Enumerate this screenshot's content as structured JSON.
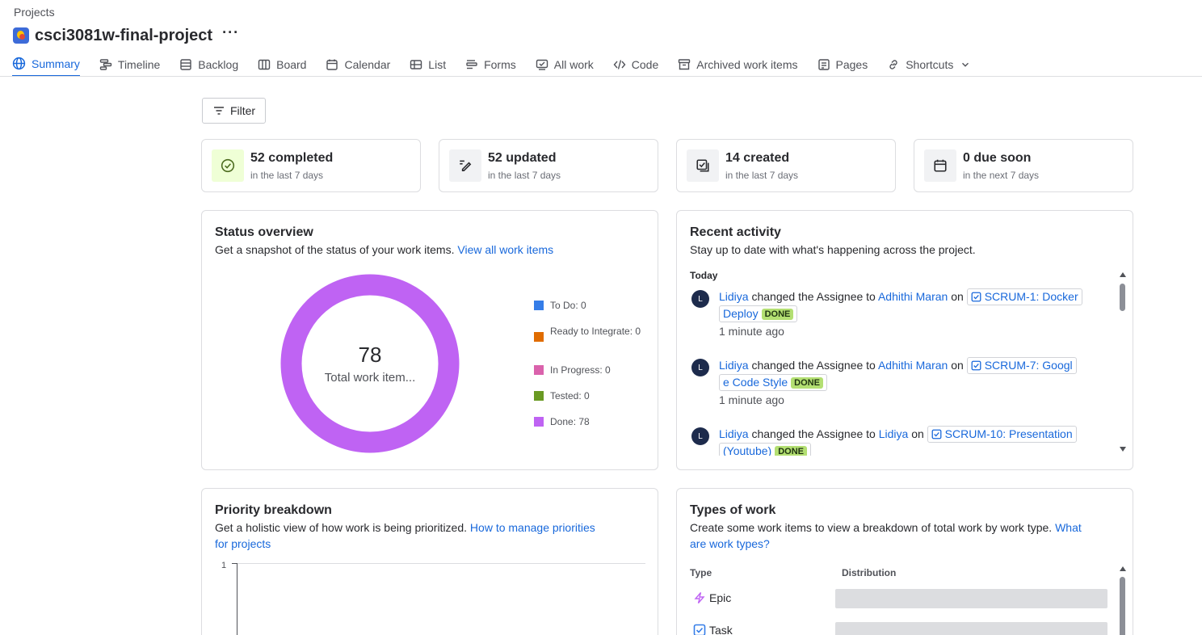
{
  "breadcrumb": "Projects",
  "project": {
    "name": "csci3081w-final-project",
    "more_label": "···"
  },
  "tabs": [
    {
      "label": "Summary",
      "icon": "globe-icon",
      "active": true
    },
    {
      "label": "Timeline",
      "icon": "timeline-icon"
    },
    {
      "label": "Backlog",
      "icon": "backlog-icon"
    },
    {
      "label": "Board",
      "icon": "board-icon"
    },
    {
      "label": "Calendar",
      "icon": "calendar-icon"
    },
    {
      "label": "List",
      "icon": "list-icon"
    },
    {
      "label": "Forms",
      "icon": "forms-icon"
    },
    {
      "label": "All work",
      "icon": "all-work-icon"
    },
    {
      "label": "Code",
      "icon": "code-icon"
    },
    {
      "label": "Archived work items",
      "icon": "archive-icon"
    },
    {
      "label": "Pages",
      "icon": "pages-icon"
    },
    {
      "label": "Shortcuts",
      "icon": "link-icon"
    }
  ],
  "filter_label": "Filter",
  "stats": [
    {
      "value": "52 completed",
      "sub": "in the last 7 days",
      "icon": "check-circle-icon"
    },
    {
      "value": "52 updated",
      "sub": "in the last 7 days",
      "icon": "edit-icon"
    },
    {
      "value": "14 created",
      "sub": "in the last 7 days",
      "icon": "created-icon"
    },
    {
      "value": "0 due soon",
      "sub": "in the next 7 days",
      "icon": "calendar-icon"
    }
  ],
  "status_overview": {
    "title": "Status overview",
    "desc": "Get a snapshot of the status of your work items.",
    "link": "View all work items",
    "total": "78",
    "total_label": "Total work item...",
    "legend": [
      {
        "label": "To Do: 0",
        "color": "#357de8"
      },
      {
        "label": "Ready to Integrate: 0",
        "color": "#e06c00"
      },
      {
        "label": "In Progress: 0",
        "color": "#da62ac"
      },
      {
        "label": "Tested: 0",
        "color": "#6a9a23"
      },
      {
        "label": "Done: 78",
        "color": "#bf63f3"
      }
    ]
  },
  "recent_activity": {
    "title": "Recent activity",
    "desc": "Stay up to date with what's happening across the project.",
    "group": "Today",
    "items": [
      {
        "avatar": "L",
        "user": "Lidiya",
        "action": "changed the Assignee to",
        "target": "Adhithi Maran",
        "on": "on",
        "item_line1": "SCRUM-1: Docker",
        "item_line2": "Deploy",
        "status": "DONE",
        "time": "1 minute ago"
      },
      {
        "avatar": "L",
        "user": "Lidiya",
        "action": "changed the Assignee to",
        "target": "Adhithi Maran",
        "on": "on",
        "item_line1": "SCRUM-7: Googl",
        "item_line2": "e Code Style",
        "status": "DONE",
        "time": "1 minute ago"
      },
      {
        "avatar": "L",
        "user": "Lidiya",
        "action": "changed the Assignee to",
        "target": "Lidiya",
        "on": "on",
        "item_line1": "SCRUM-10: Presentation",
        "item_line2": "(Youtube)",
        "status": "DONE",
        "time": ""
      }
    ]
  },
  "priority": {
    "title": "Priority breakdown",
    "desc": "Get a holistic view of how work is being prioritized.",
    "link_line1": "How to manage priorities",
    "link_line2": "for projects",
    "y_tick": "1"
  },
  "types_of_work": {
    "title": "Types of work",
    "desc": "Create some work items to view a breakdown of total work by work type.",
    "link_line1": "What",
    "link_line2": "are work types?",
    "col_type": "Type",
    "col_dist": "Distribution",
    "rows": [
      {
        "label": "Epic",
        "icon": "epic-icon",
        "color": "#bf63f3"
      },
      {
        "label": "Task",
        "icon": "task-icon",
        "color": "#357de8"
      }
    ]
  }
}
